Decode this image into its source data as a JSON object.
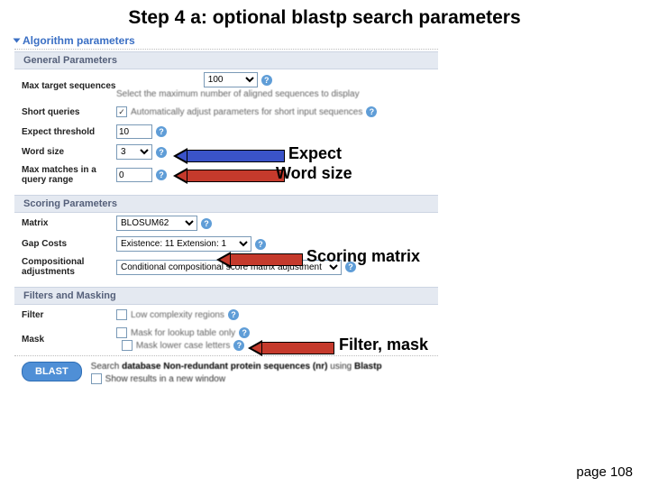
{
  "title": "Step 4 a: optional blastp search parameters",
  "collapse": "Algorithm parameters",
  "sections": {
    "general": "General Parameters",
    "scoring": "Scoring Parameters",
    "filters": "Filters and Masking"
  },
  "labels": {
    "max_target": "Max target sequences",
    "short_queries": "Short queries",
    "expect": "Expect threshold",
    "word_size": "Word size",
    "max_matches": "Max matches in a query range",
    "matrix": "Matrix",
    "gap_costs": "Gap Costs",
    "comp_adj": "Compositional adjustments",
    "filter": "Filter",
    "mask": "Mask"
  },
  "values": {
    "max_target": "100",
    "max_target_desc": "Select the maximum number of aligned sequences to display",
    "short_queries_desc": "Automatically adjust parameters for short input sequences",
    "expect": "10",
    "word_size": "3",
    "max_matches": "0",
    "matrix": "BLOSUM62",
    "gap_costs": "Existence: 11 Extension: 1",
    "comp_adj": "Conditional compositional score matrix adjustment",
    "filter_opt": "Low complexity regions",
    "mask_opt1": "Mask for lookup table only",
    "mask_opt2": "Mask lower case letters"
  },
  "bottom": {
    "button": "BLAST",
    "line1a": "Search ",
    "line1b": "database Non-redundant protein sequences (nr)",
    "line1c": " using ",
    "line1d": "Blastp",
    "show_results": "Show results in a new window"
  },
  "annotations": {
    "expect": "Expect",
    "word_size": "Word size",
    "scoring": "Scoring matrix",
    "filter": "Filter, mask"
  },
  "page": "page 108"
}
